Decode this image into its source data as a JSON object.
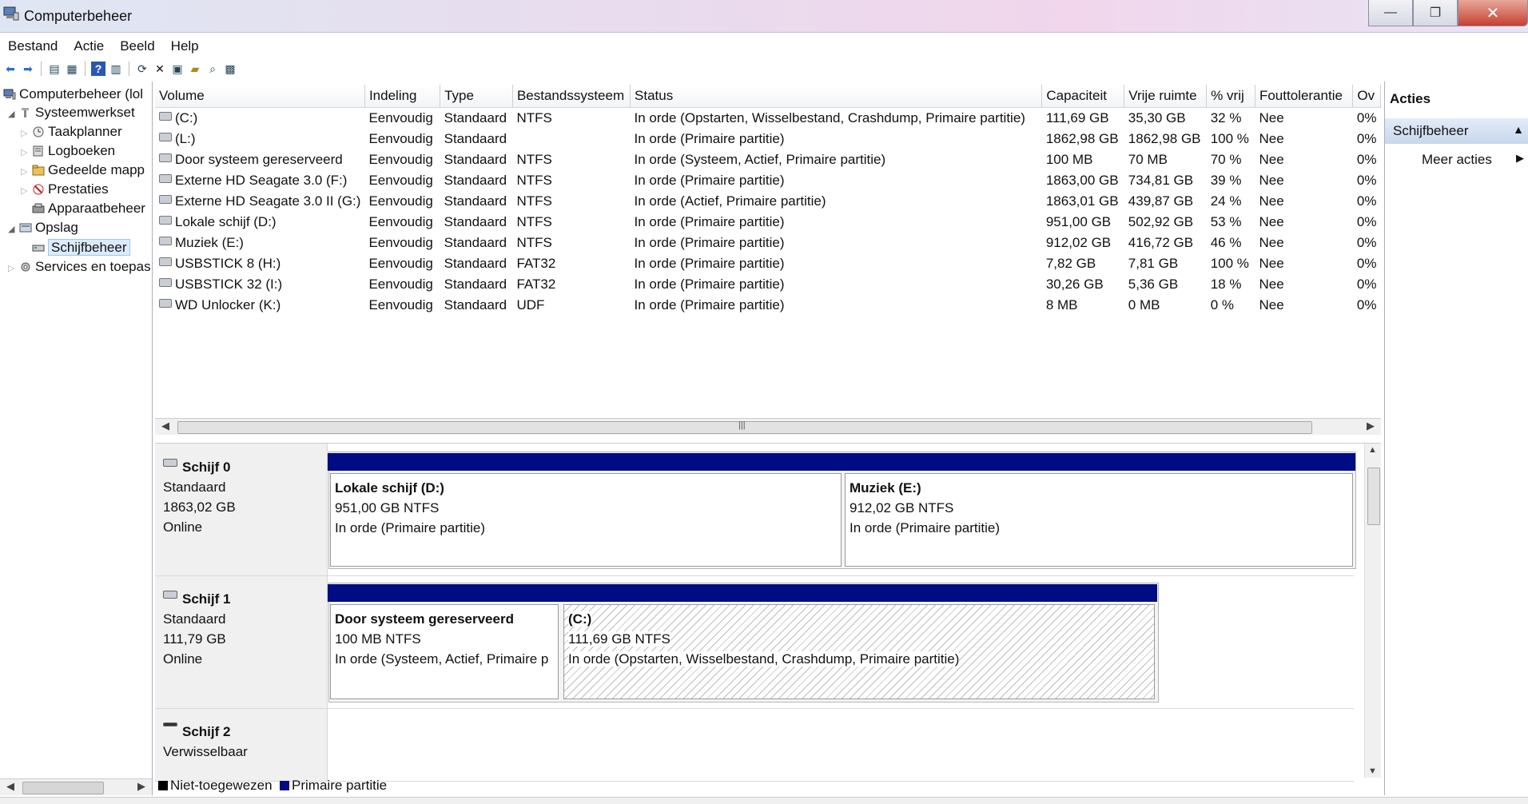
{
  "window": {
    "title": "Computerbeheer",
    "minimize": "—",
    "restore": "❐",
    "close": "✕"
  },
  "menu": [
    "Bestand",
    "Actie",
    "Beeld",
    "Help"
  ],
  "tree": {
    "root": "Computerbeheer (lol",
    "systeem": "Systeemwerkset",
    "taakplanner": "Taakplanner",
    "logboeken": "Logboeken",
    "gedeelde": "Gedeelde mapp",
    "prestaties": "Prestaties",
    "apparaat": "Apparaatbeheer",
    "opslag": "Opslag",
    "schijfbeheer": "Schijfbeheer",
    "services": "Services en toepas"
  },
  "volumes": {
    "headers": [
      "Volume",
      "Indeling",
      "Type",
      "Bestandssysteem",
      "Status",
      "Capaciteit",
      "Vrije ruimte",
      "% vrij",
      "Fouttolerantie",
      "Ov"
    ],
    "rows": [
      [
        "(C:)",
        "Eenvoudig",
        "Standaard",
        "NTFS",
        "In orde (Opstarten, Wisselbestand, Crashdump, Primaire partitie)",
        "111,69 GB",
        "35,30 GB",
        "32 %",
        "Nee",
        "0%"
      ],
      [
        "(L:)",
        "Eenvoudig",
        "Standaard",
        "",
        "In orde (Primaire partitie)",
        "1862,98 GB",
        "1862,98 GB",
        "100 %",
        "Nee",
        "0%"
      ],
      [
        "Door systeem gereserveerd",
        "Eenvoudig",
        "Standaard",
        "NTFS",
        "In orde (Systeem, Actief, Primaire partitie)",
        "100 MB",
        "70 MB",
        "70 %",
        "Nee",
        "0%"
      ],
      [
        "Externe HD Seagate 3.0 (F:)",
        "Eenvoudig",
        "Standaard",
        "NTFS",
        "In orde (Primaire partitie)",
        "1863,00 GB",
        "734,81 GB",
        "39 %",
        "Nee",
        "0%"
      ],
      [
        "Externe HD Seagate 3.0 II (G:)",
        "Eenvoudig",
        "Standaard",
        "NTFS",
        "In orde (Actief, Primaire partitie)",
        "1863,01 GB",
        "439,87 GB",
        "24 %",
        "Nee",
        "0%"
      ],
      [
        "Lokale schijf (D:)",
        "Eenvoudig",
        "Standaard",
        "NTFS",
        "In orde (Primaire partitie)",
        "951,00 GB",
        "502,92 GB",
        "53 %",
        "Nee",
        "0%"
      ],
      [
        "Muziek (E:)",
        "Eenvoudig",
        "Standaard",
        "NTFS",
        "In orde (Primaire partitie)",
        "912,02 GB",
        "416,72 GB",
        "46 %",
        "Nee",
        "0%"
      ],
      [
        "USBSTICK 8 (H:)",
        "Eenvoudig",
        "Standaard",
        "FAT32",
        "In orde (Primaire partitie)",
        "7,82 GB",
        "7,81 GB",
        "100 %",
        "Nee",
        "0%"
      ],
      [
        "USBSTICK 32 (I:)",
        "Eenvoudig",
        "Standaard",
        "FAT32",
        "In orde (Primaire partitie)",
        "30,26 GB",
        "5,36 GB",
        "18 %",
        "Nee",
        "0%"
      ],
      [
        "WD Unlocker (K:)",
        "Eenvoudig",
        "Standaard",
        "UDF",
        "In orde (Primaire partitie)",
        "8 MB",
        "0 MB",
        "0 %",
        "Nee",
        "0%"
      ]
    ]
  },
  "disks": [
    {
      "name": "Schijf 0",
      "type": "Standaard",
      "size": "1863,02 GB",
      "state": "Online",
      "partitions": [
        {
          "label": "Lokale schijf  (D:)",
          "size": "951,00 GB NTFS",
          "status": "In orde (Primaire partitie)"
        },
        {
          "label": "Muziek  (E:)",
          "size": "912,02 GB NTFS",
          "status": "In orde (Primaire partitie)"
        }
      ]
    },
    {
      "name": "Schijf 1",
      "type": "Standaard",
      "size": "111,79 GB",
      "state": "Online",
      "partitions": [
        {
          "label": "Door systeem gereserveerd",
          "size": "100 MB NTFS",
          "status": "In orde (Systeem, Actief, Primaire p"
        },
        {
          "label": "(C:)",
          "size": "111,69 GB NTFS",
          "status": "In orde (Opstarten, Wisselbestand, Crashdump, Primaire partitie)"
        }
      ]
    },
    {
      "name": "Schijf 2",
      "type": "Verwisselbaar",
      "size": "",
      "state": "",
      "partitions": []
    }
  ],
  "legend": {
    "unallocated": "Niet-toegewezen",
    "primary": "Primaire partitie"
  },
  "actions": {
    "title": "Acties",
    "section": "Schijfbeheer",
    "more": "Meer acties"
  },
  "colors": {
    "primary_partition": "#000c84",
    "unallocated": "#000000",
    "selection": "#dcebfc"
  }
}
